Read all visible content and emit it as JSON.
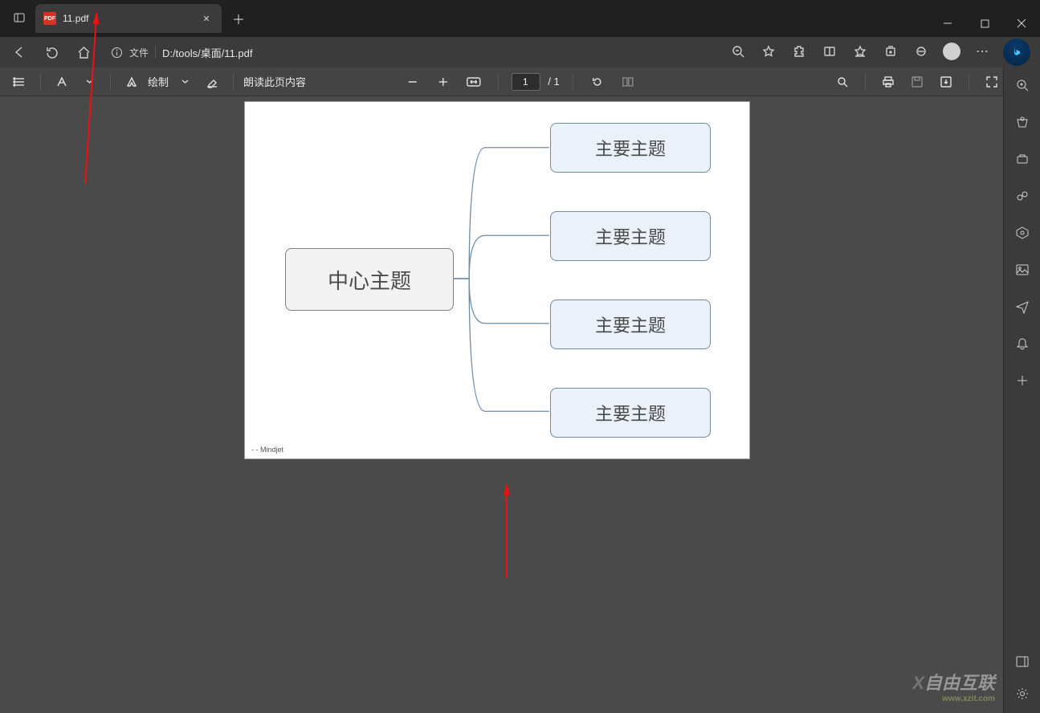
{
  "tab": {
    "title": "11.pdf",
    "icon_label": "PDF"
  },
  "address": {
    "type_label": "文件",
    "path": "D:/tools/桌面/11.pdf"
  },
  "pdf_toolbar": {
    "draw_label": "绘制",
    "read_aloud": "朗读此页内容",
    "page_current": "1",
    "page_total": "/ 1"
  },
  "mindmap": {
    "center": "中心主题",
    "nodes": [
      "主要主题",
      "主要主题",
      "主要主题",
      "主要主题"
    ],
    "footer": "-  - Mindjet"
  },
  "watermark": {
    "brand": "自由互联",
    "url": "www.xzit.com"
  }
}
